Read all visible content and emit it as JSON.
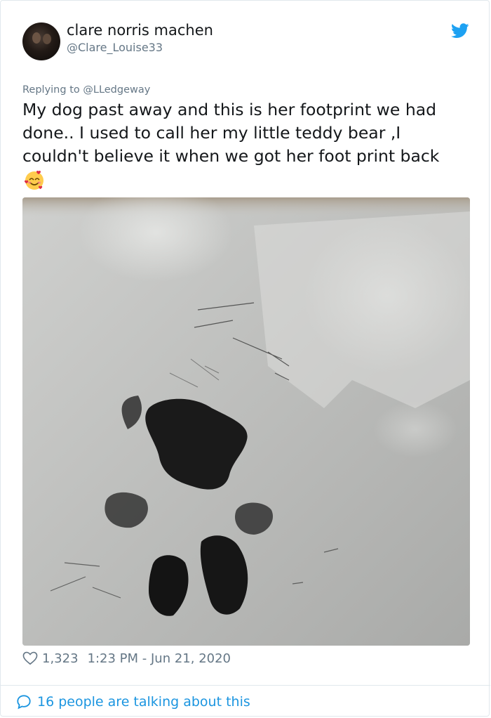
{
  "author": {
    "display_name": "clare norris machen",
    "handle": "@Clare_Louise33",
    "avatar_icon": "profile-photo"
  },
  "brand": {
    "icon": "twitter-bird-icon",
    "color": "#1da1f2"
  },
  "reply": {
    "prefix": "Replying to ",
    "mention": "@LLedgeway"
  },
  "tweet": {
    "lines": [
      "My dog past away and this is her footprint we had",
      "done.. I used to call her my little teddy bear ,I",
      "couldn't believe it when we got her foot print back"
    ],
    "emoji": "smiling-face-with-hearts-emoji"
  },
  "media": {
    "type": "photo"
  },
  "stats": {
    "likes": "1,323",
    "timestamp": "1:23 PM - Jun 21, 2020"
  },
  "conversation": {
    "label": "16 people are talking about this"
  },
  "colors": {
    "text": "#14171a",
    "secondary": "#657786",
    "link": "#1b95e0",
    "border": "#e1e8ed"
  }
}
